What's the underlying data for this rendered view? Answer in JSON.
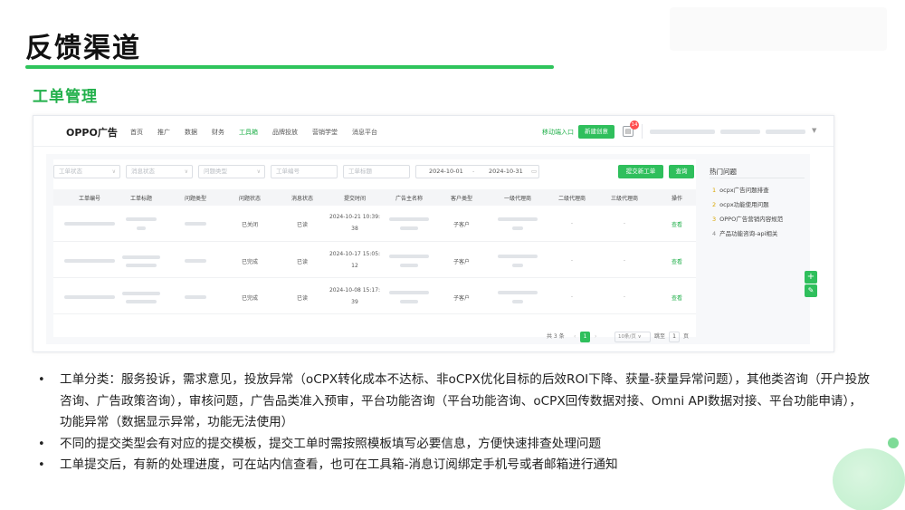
{
  "slide": {
    "title": "反馈渠道",
    "section": "工单管理"
  },
  "topnav": {
    "brand": "OPPO广告",
    "items": [
      "首页",
      "推广",
      "数据",
      "财务",
      "工具箱",
      "品牌投放",
      "营销学堂",
      "消息平台"
    ],
    "active_item": "工具箱",
    "mobile_link": "移动端入口",
    "create_button": "新建创意",
    "message_count": "14"
  },
  "filters": {
    "status": "工单状态",
    "message_status": "消息状态",
    "question_type": "问题类型",
    "ticket_no": "工单编号",
    "ticket_title": "工单标题",
    "date_start": "2024-10-01",
    "date_sep": "-",
    "date_end": "2024-10-31",
    "submit_button": "提交新工单",
    "query_button": "查询"
  },
  "table": {
    "headers": [
      "工单编号",
      "工单标题",
      "问题类型",
      "问题状态",
      "消息状态",
      "提交时间",
      "广告主名称",
      "客户类型",
      "一级代理商",
      "二级代理商",
      "三级代理商",
      "操作"
    ],
    "rows": [
      {
        "status": "已关闭",
        "msg": "已读",
        "time_a": "2024-10-21 10:39:",
        "time_b": "38",
        "cust": "子客户",
        "agent2": "-",
        "agent3": "-",
        "action": "查看"
      },
      {
        "status": "已完成",
        "msg": "已读",
        "time_a": "2024-10-17 15:05:",
        "time_b": "12",
        "cust": "子客户",
        "agent2": "-",
        "agent3": "-",
        "action": "查看"
      },
      {
        "status": "已完成",
        "msg": "已读",
        "time_a": "2024-10-08 15:17:",
        "time_b": "39",
        "cust": "子客户",
        "agent2": "-",
        "agent3": "-",
        "action": "查看"
      }
    ]
  },
  "pagination": {
    "total": "共 3 条",
    "current_page": "1",
    "page_size": "10条/页",
    "goto": "跳至",
    "goto_value": "1",
    "page_unit": "页"
  },
  "hot_questions": {
    "title": "热门问题",
    "items": [
      {
        "num": "1",
        "text": "ocpx广告问题排查"
      },
      {
        "num": "2",
        "text": "ocpx功能使用问题"
      },
      {
        "num": "3",
        "text": "OPPO广告营销内容规范"
      },
      {
        "num": "4",
        "text": "产品功能咨询-api相关"
      }
    ]
  },
  "bullets": [
    "工单分类：服务投诉，需求意见，投放异常（oCPX转化成本不达标、非oCPX优化目标的后效ROI下降、获量-获量异常问题），其他类咨询（开户投放咨询、广告政策咨询），审核问题，广告品类准入预审，平台功能咨询（平台功能咨询、oCPX回传数据对接、Omni API数据对接、平台功能申请），功能异常（数据显示异常，功能无法使用）",
    "不同的提交类型会有对应的提交模板，提交工单时需按照模板填写必要信息，方便快速排查处理问题",
    "工单提交后，有新的处理进度，可在站内信查看，也可在工具箱-消息订阅绑定手机号或者邮箱进行通知"
  ],
  "colors": {
    "accent": "#2fbf5c",
    "title_rule": "#2fc45c",
    "section_title": "#22b04b"
  }
}
